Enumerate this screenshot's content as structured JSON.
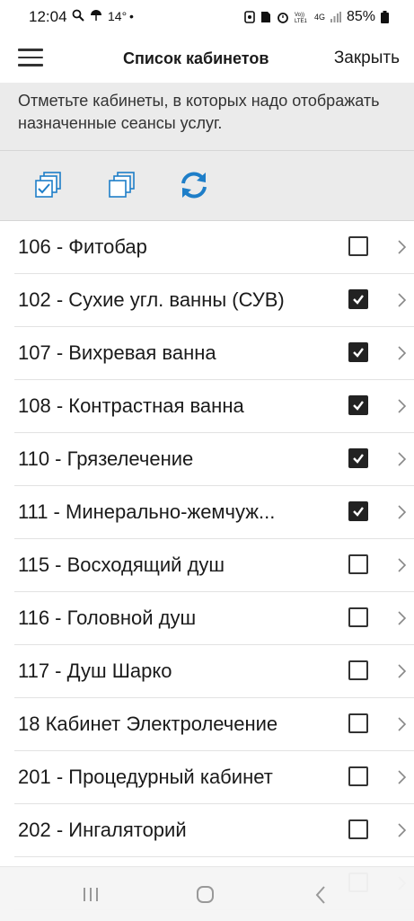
{
  "status_bar": {
    "time": "12:04",
    "temperature": "14°",
    "battery": "85%",
    "icons_left": [
      "search-icon",
      "umbrella-icon"
    ],
    "icons_right": [
      "nfc-icon",
      "sim-icon",
      "alarm-icon",
      "volte-icon",
      "4g-icon",
      "signal-icon",
      "battery-icon"
    ],
    "network_label": "4G"
  },
  "header": {
    "title": "Список кабинетов",
    "close_label": "Закрыть"
  },
  "instructions": "Отметьте кабинеты, в которых надо отображать назначенные сеансы услуг.",
  "toolbar": {
    "buttons": [
      "select-all-icon",
      "deselect-all-icon",
      "refresh-icon"
    ]
  },
  "colors": {
    "accent": "#1e7ec8",
    "panel_bg": "#ebebeb",
    "divider": "#e2e2e2"
  },
  "rooms": [
    {
      "label": "106 - Фитобар",
      "checked": false
    },
    {
      "label": "102 - Сухие угл. ванны (СУВ)",
      "checked": true
    },
    {
      "label": "107 - Вихревая ванна",
      "checked": true
    },
    {
      "label": "108 - Контрастная ванна",
      "checked": true
    },
    {
      "label": "110 - Грязелечение",
      "checked": true
    },
    {
      "label": "111 - Минерально-жемчуж...",
      "checked": true
    },
    {
      "label": "115 - Восходящий душ",
      "checked": false
    },
    {
      "label": "116 - Головной душ",
      "checked": false
    },
    {
      "label": "117 - Душ Шарко",
      "checked": false
    },
    {
      "label": "18 Кабинет Электролечение",
      "checked": false
    },
    {
      "label": "201 - Процедурный кабинет",
      "checked": false
    },
    {
      "label": "202 - Ингаляторий",
      "checked": false
    },
    {
      "label": "",
      "checked": false
    }
  ],
  "navigation": [
    "recents-icon",
    "home-icon",
    "back-icon"
  ]
}
